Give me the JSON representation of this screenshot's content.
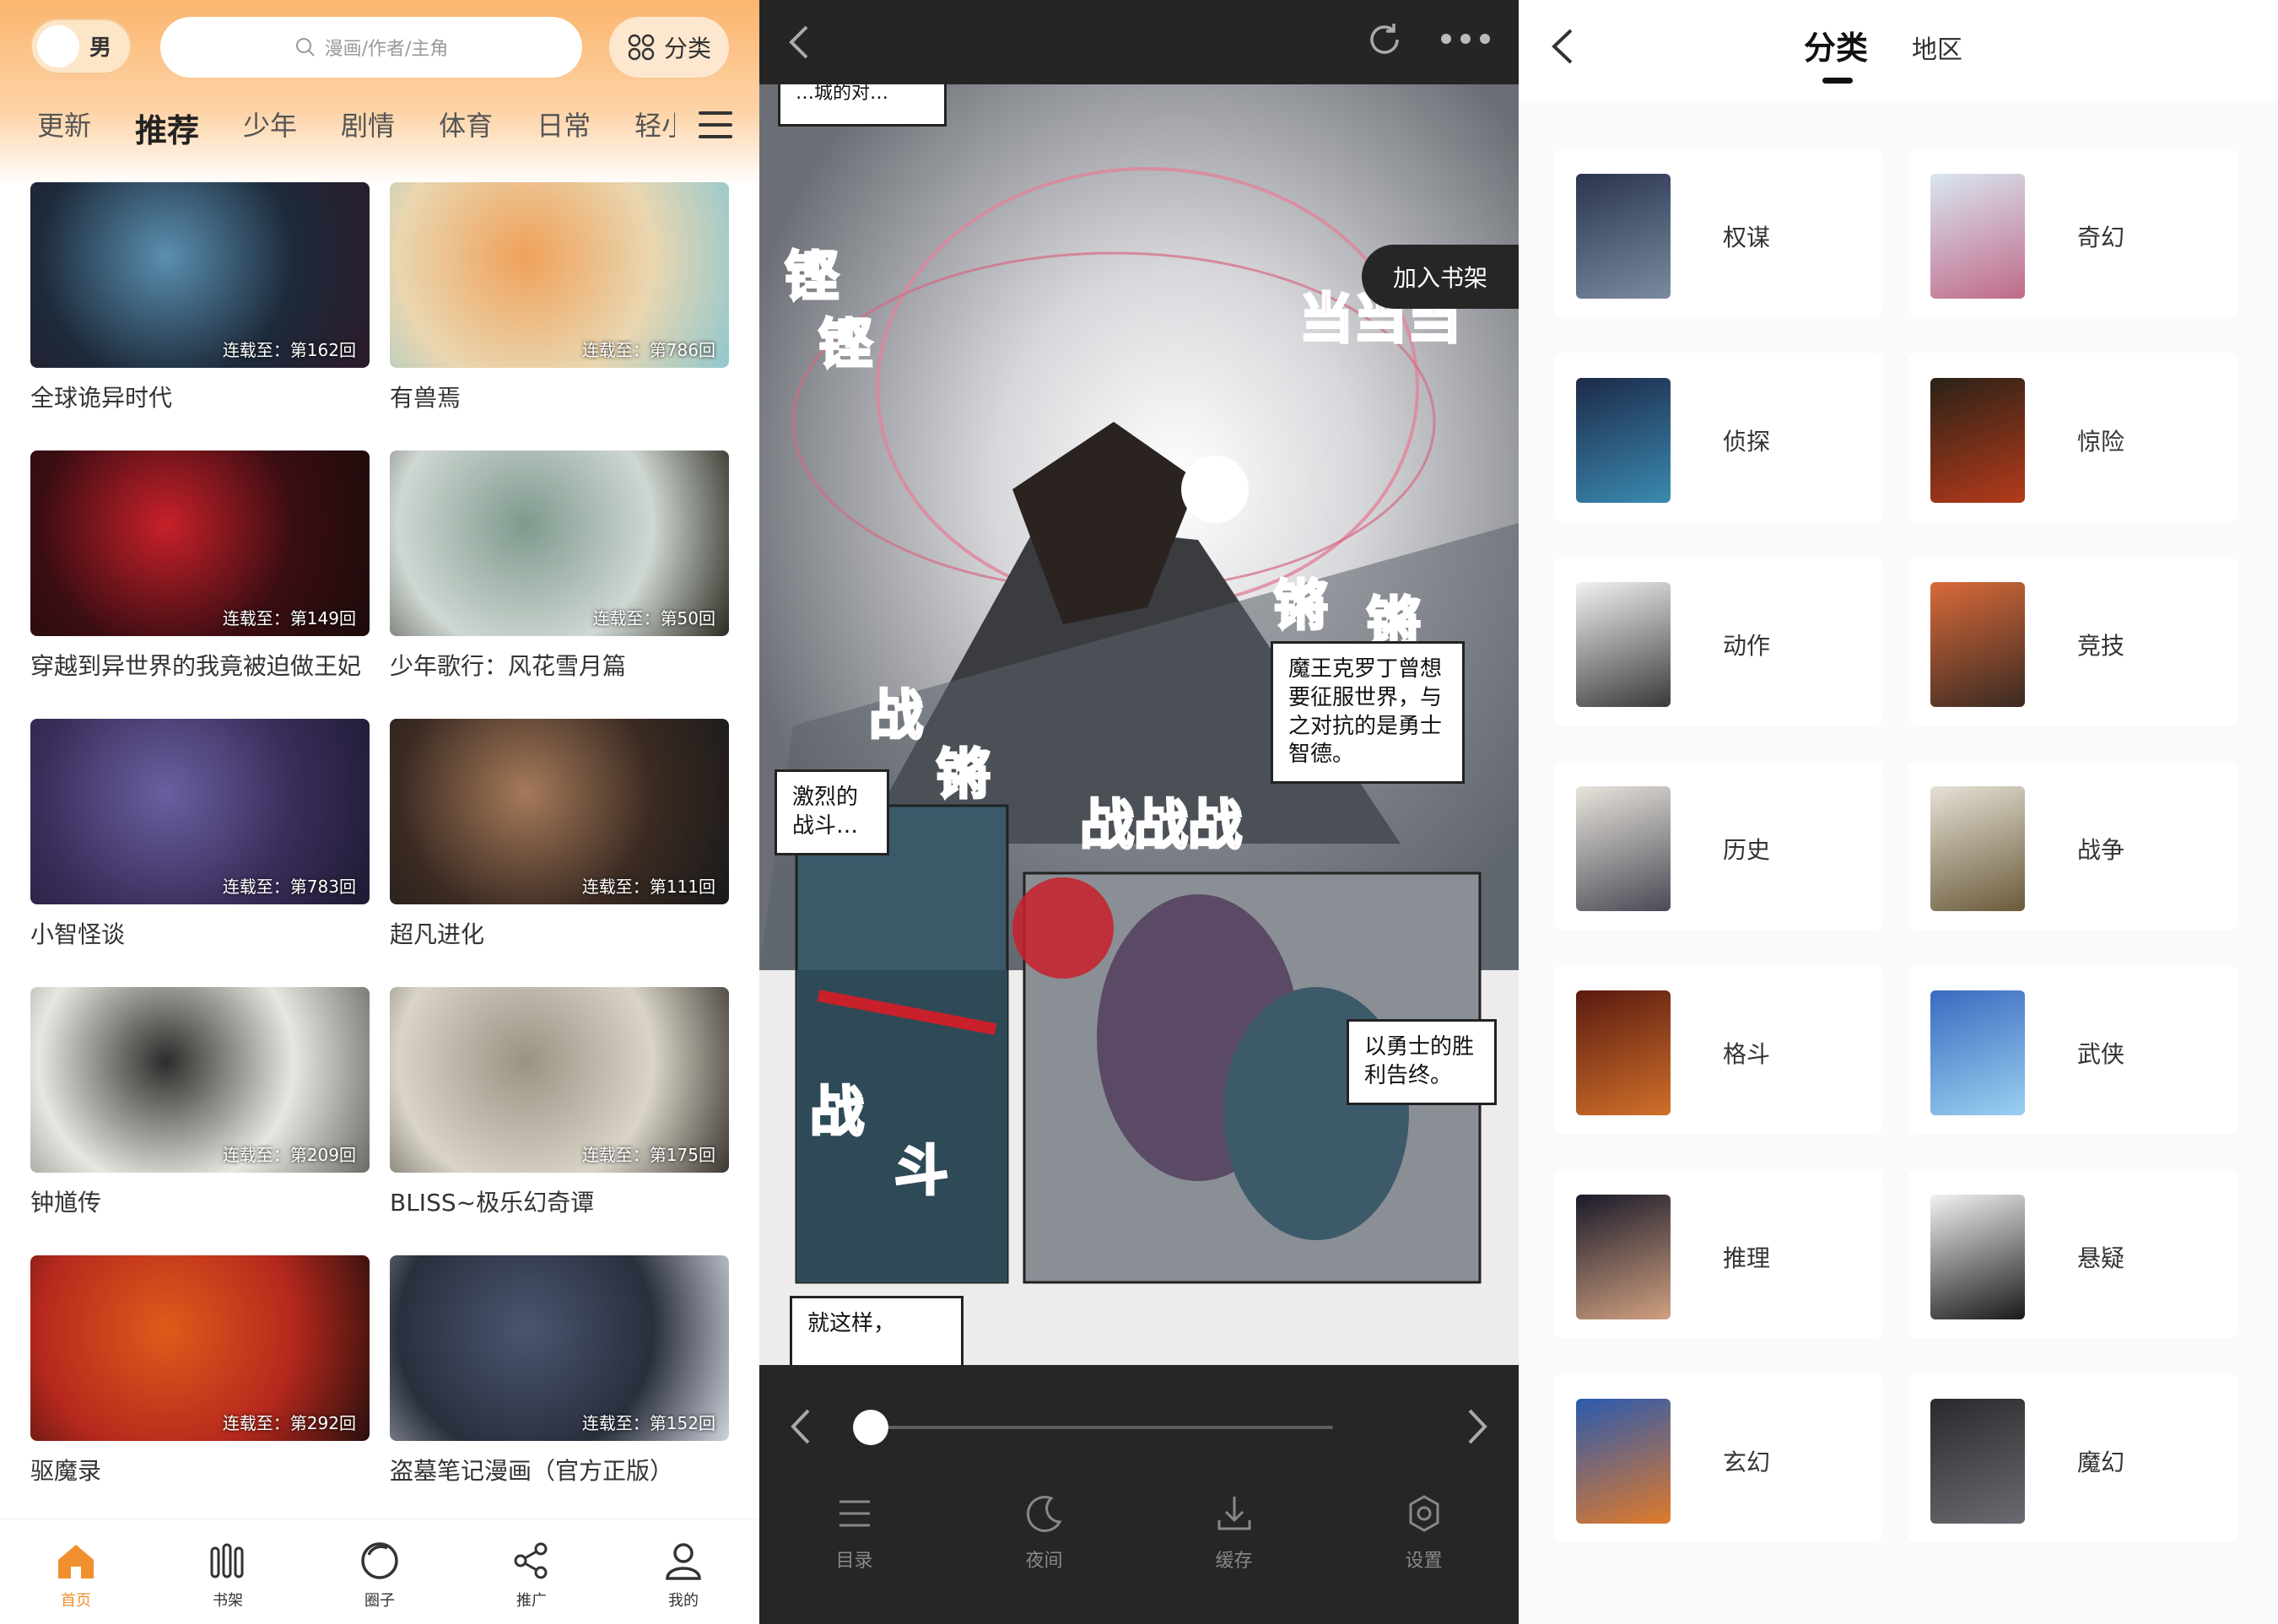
{
  "home": {
    "gender_label": "男",
    "search_placeholder": "漫画/作者/主角",
    "category_button": "分类",
    "tabs": [
      "更新",
      "推荐",
      "少年",
      "剧情",
      "体育",
      "日常",
      "轻小说"
    ],
    "active_tab": "推荐",
    "comics": [
      {
        "title": "全球诡异时代",
        "episode": "连载至：第162回",
        "colors": [
          "#1d2a3a",
          "#5a8fb0",
          "#2b1a2a"
        ]
      },
      {
        "title": "有兽焉",
        "episode": "连载至：第786回",
        "colors": [
          "#e9d6b0",
          "#f0a15a",
          "#8fc7cf"
        ]
      },
      {
        "title": "穿越到异世界的我竟被迫做王妃",
        "episode": "连载至：第149回",
        "colors": [
          "#3a0d12",
          "#c8202a",
          "#1b0b0b"
        ]
      },
      {
        "title": "少年歌行：风花雪月篇",
        "episode": "连载至：第50回",
        "colors": [
          "#cfd7d2",
          "#7f9a8e",
          "#2a2a20"
        ]
      },
      {
        "title": "小智怪谈",
        "episode": "连载至：第783回",
        "colors": [
          "#3a2d5a",
          "#6a5fa0",
          "#1e1a33"
        ]
      },
      {
        "title": "超凡进化",
        "episode": "连载至：第111回",
        "colors": [
          "#3a2a22",
          "#a67a5a",
          "#1a1a1a"
        ]
      },
      {
        "title": "钟馗传",
        "episode": "连载至：第209回",
        "colors": [
          "#e8e6e0",
          "#2a2d2a",
          "#6a6a66"
        ]
      },
      {
        "title": "BLISS~极乐幻奇谭",
        "episode": "连载至：第175回",
        "colors": [
          "#d9d4c7",
          "#9a9384",
          "#3a3630"
        ]
      },
      {
        "title": "驱魔录",
        "episode": "连载至：第292回",
        "colors": [
          "#b5281d",
          "#e05a1a",
          "#2a0f0d"
        ]
      },
      {
        "title": "盗墓笔记漫画（官方正版）",
        "episode": "连载至：第152回",
        "colors": [
          "#2a2f3d",
          "#4a5570",
          "#cfd3dc"
        ]
      }
    ],
    "nav": [
      {
        "label": "首页",
        "icon": "home-icon",
        "active": true
      },
      {
        "label": "书架",
        "icon": "bookshelf-icon",
        "active": false
      },
      {
        "label": "圈子",
        "icon": "circle-icon",
        "active": false
      },
      {
        "label": "推广",
        "icon": "share-icon",
        "active": false
      },
      {
        "label": "我的",
        "icon": "user-icon",
        "active": false
      }
    ],
    "accent_color": "#f08f2e"
  },
  "reader": {
    "add_to_shelf": "加入书架",
    "bubbles": {
      "top": "…城的对…",
      "villain": "魔王克罗丁曾想要征服世界，与之对抗的是勇士智德。",
      "battle": "激烈的战斗…",
      "victory": "以勇士的胜利告终。",
      "bottom": "就这样，"
    },
    "sfx": [
      "铿",
      "铿",
      "当当当",
      "锵",
      "锵",
      "战",
      "锵",
      "战战战",
      "战",
      "斗"
    ],
    "progress": 0.02,
    "tools": [
      {
        "label": "目录",
        "icon": "catalog-icon"
      },
      {
        "label": "夜间",
        "icon": "moon-icon"
      },
      {
        "label": "缓存",
        "icon": "download-icon"
      },
      {
        "label": "设置",
        "icon": "settings-icon"
      }
    ]
  },
  "categories": {
    "tabs": [
      "分类",
      "地区"
    ],
    "active_tab": "分类",
    "items": [
      {
        "name": "权谋",
        "colors": [
          "#2a3550",
          "#7a8aa0"
        ]
      },
      {
        "name": "奇幻",
        "colors": [
          "#d9e6f0",
          "#c06a8a"
        ]
      },
      {
        "name": "侦探",
        "colors": [
          "#1d2a4a",
          "#3a8ab0"
        ]
      },
      {
        "name": "惊险",
        "colors": [
          "#2a2218",
          "#b53a1a"
        ]
      },
      {
        "name": "动作",
        "colors": [
          "#f2f2f2",
          "#3a3a3a"
        ]
      },
      {
        "name": "竞技",
        "colors": [
          "#d96a3a",
          "#3a2a22"
        ]
      },
      {
        "name": "历史",
        "colors": [
          "#e8e4dc",
          "#4a4a55"
        ]
      },
      {
        "name": "战争",
        "colors": [
          "#e6e2d6",
          "#6a5a3a"
        ]
      },
      {
        "name": "格斗",
        "colors": [
          "#5a1a10",
          "#d0702a"
        ]
      },
      {
        "name": "武侠",
        "colors": [
          "#3a6ac0",
          "#9ad0f0"
        ]
      },
      {
        "name": "推理",
        "colors": [
          "#1a1a2a",
          "#d0a080"
        ]
      },
      {
        "name": "悬疑",
        "colors": [
          "#f2f2f2",
          "#1a1a1a"
        ]
      },
      {
        "name": "玄幻",
        "colors": [
          "#2a5ab0",
          "#e07a2a"
        ]
      },
      {
        "name": "魔幻",
        "colors": [
          "#2a2a2e",
          "#6a6a70"
        ]
      }
    ]
  }
}
